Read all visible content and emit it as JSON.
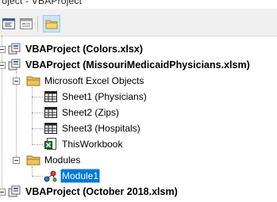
{
  "window": {
    "title": "roject - VBAProject"
  },
  "toolbar": {
    "buttons": [
      {
        "icon": "view-code-icon"
      },
      {
        "icon": "view-object-icon"
      },
      {
        "icon": "toggle-folders-icon"
      }
    ]
  },
  "tree": {
    "projects": [
      {
        "label": "VBAProject (Colors.xlsx)"
      },
      {
        "label": "VBAProject (MissouriMedicaidPhysicians.xlsm)",
        "folders": [
          {
            "label": "Microsoft Excel Objects",
            "items": [
              {
                "label": "Sheet1 (Physicians)",
                "icon": "worksheet-icon"
              },
              {
                "label": "Sheet2 (Zips)",
                "icon": "worksheet-icon"
              },
              {
                "label": "Sheet3 (Hospitals)",
                "icon": "worksheet-icon"
              },
              {
                "label": "ThisWorkbook",
                "icon": "workbook-icon"
              }
            ]
          },
          {
            "label": "Modules",
            "items": [
              {
                "label": "Module1",
                "icon": "module-icon",
                "selected": true
              }
            ]
          }
        ]
      },
      {
        "label": "VBAProject (October 2018.xlsm)"
      }
    ]
  }
}
